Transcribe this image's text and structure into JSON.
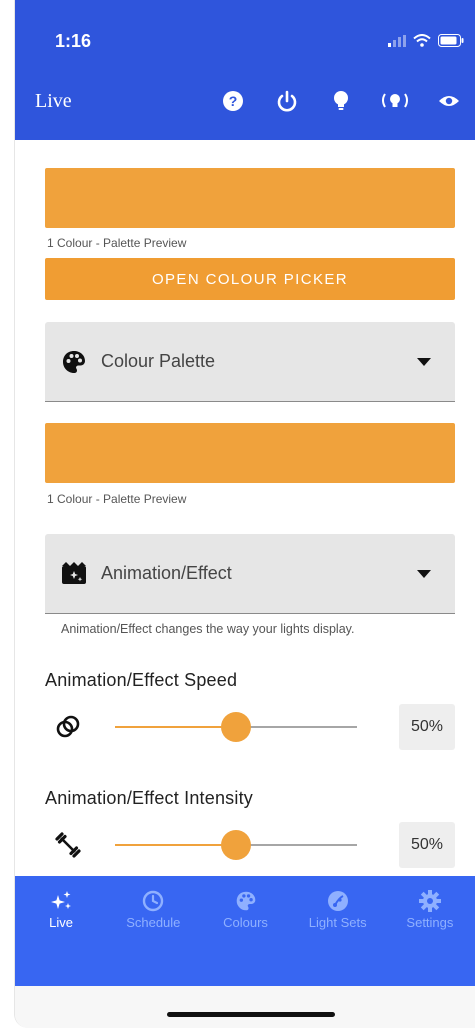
{
  "status_bar": {
    "time": "1:16"
  },
  "header": {
    "title": "Live"
  },
  "colour_preview": {
    "color": "#F0A23C",
    "caption": "1 Colour - Palette Preview"
  },
  "picker_button": {
    "label": "OPEN COLOUR PICKER",
    "color": "#F09D33"
  },
  "palette_select": {
    "label": "Colour Palette",
    "icon": "palette-icon"
  },
  "palette_preview": {
    "color": "#F0A23C",
    "caption": "1 Colour - Palette Preview"
  },
  "effect_select": {
    "label": "Animation/Effect",
    "icon": "clapperboard-icon",
    "helper": "Animation/Effect changes the way your lights display."
  },
  "speed": {
    "title": "Animation/Effect Speed",
    "value": 50,
    "value_label": "50%",
    "icon": "rings-icon"
  },
  "intensity": {
    "title": "Animation/Effect Intensity",
    "value": 50,
    "value_label": "50%",
    "icon": "dumbbell-icon"
  },
  "nav": {
    "items": [
      {
        "label": "Live",
        "icon": "sparkles-icon",
        "active": true
      },
      {
        "label": "Schedule",
        "icon": "clock-icon",
        "active": false
      },
      {
        "label": "Colours",
        "icon": "palette-icon",
        "active": false
      },
      {
        "label": "Light Sets",
        "icon": "lightbulb-icon",
        "active": false
      },
      {
        "label": "Settings",
        "icon": "gear-icon",
        "active": false
      }
    ]
  },
  "colors": {
    "header_bg": "#2F55DC",
    "nav_bg": "#3866F2",
    "accent": "#F0A23C"
  }
}
